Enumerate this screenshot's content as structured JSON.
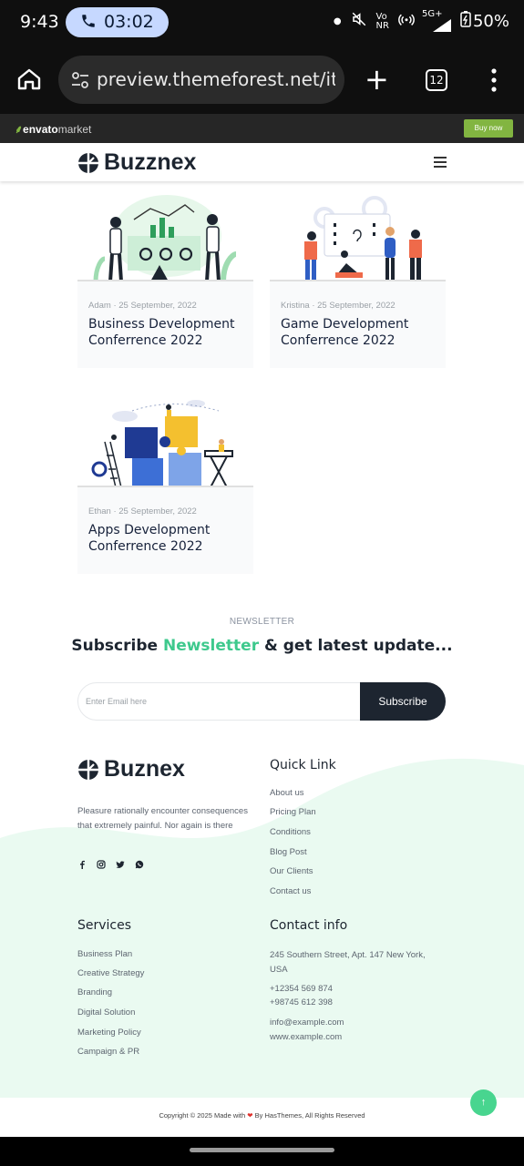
{
  "status_bar": {
    "time": "9:43",
    "call_timer": "03:02",
    "network": "5G+",
    "volte": "Vo",
    "nr": "NR",
    "battery": "50%"
  },
  "browser": {
    "url": "preview.themeforest.net/ite",
    "tab_count": "12"
  },
  "envato_bar": {
    "logo_bold": "envato",
    "logo_light": "market",
    "buy_label": "Buy now"
  },
  "site": {
    "brand": "Buzznex"
  },
  "posts": [
    {
      "author": "Adam",
      "date": "25 September, 2022",
      "meta": "Adam · 25 September, 2022",
      "title": "Business Development Conferrence 2022"
    },
    {
      "author": "Kristina",
      "date": "25 September, 2022",
      "meta": "Kristina · 25 September, 2022",
      "title": "Game Development Conferrence 2022"
    },
    {
      "author": "Ethan",
      "date": "25 September, 2022",
      "meta": "Ethan · 25 September, 2022",
      "title": "Apps Development Conferrence 2022"
    }
  ],
  "newsletter": {
    "label": "NEWSLETTER",
    "heading_prefix": "Subscribe",
    "heading_highlight": "Newsletter",
    "heading_suffix": "& get latest update...",
    "email_placeholder": "Enter Email here",
    "subscribe_label": "Subscribe"
  },
  "footer": {
    "brand": "Buznex",
    "about_text": "Pleasure rationally encounter consequences that extremely painful. Nor again is there",
    "social_icons": [
      "facebook-icon",
      "instagram-icon",
      "twitter-icon",
      "whatsapp-icon"
    ],
    "quick_link_title": "Quick Link",
    "quick_links": [
      "About us",
      "Pricing Plan",
      "Conditions",
      "Blog Post",
      "Our Clients",
      "Contact us"
    ],
    "services_title": "Services",
    "services": [
      "Business Plan",
      "Creative Strategy",
      "Branding",
      "Digital Solution",
      "Marketing Policy",
      "Campaign & PR"
    ],
    "contact_title": "Contact info",
    "address": "245 Southern Street, Apt. 147 New York, USA",
    "phones": [
      "+12354 569 874",
      "+98745 612 398"
    ],
    "emails": [
      "info@example.com",
      "www.example.com"
    ],
    "copyright_before": "Copyright © 2025 Made with",
    "copyright_after": "By HasThemes, All Rights Reserved",
    "to_top": "↑"
  },
  "colors": {
    "accent": "#3ec98d",
    "dark": "#1d2530",
    "footer_wave": "#eafaf1",
    "buy_button": "#82b541"
  }
}
